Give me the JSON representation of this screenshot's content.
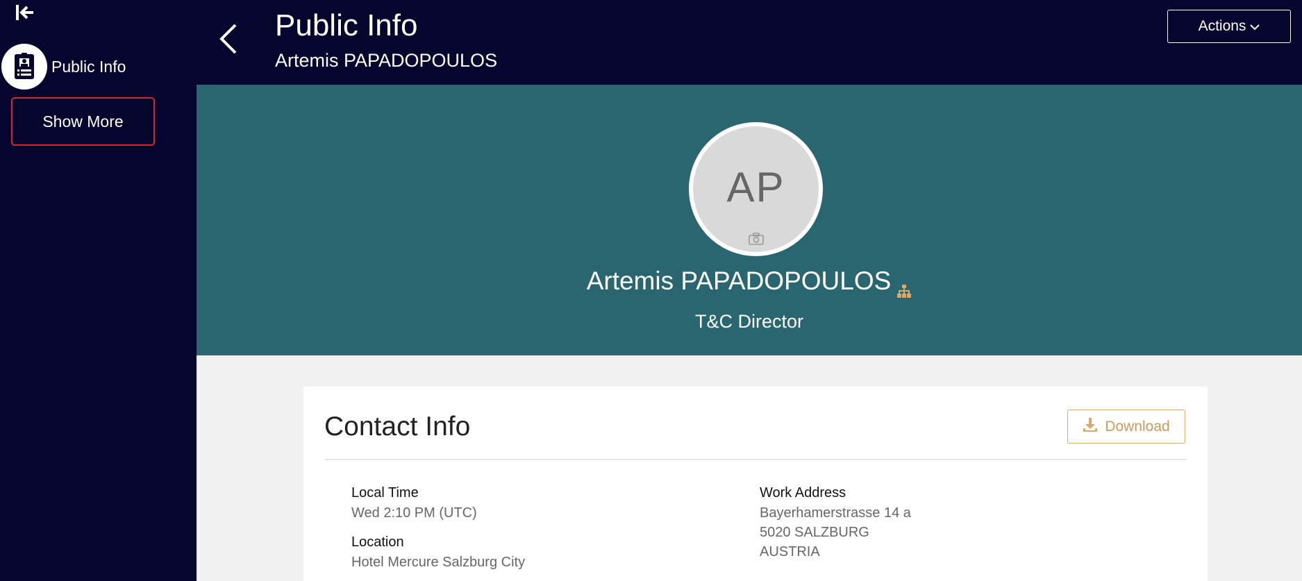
{
  "sidebar": {
    "items": [
      {
        "label": "Public Info",
        "icon": "id-badge-icon"
      }
    ],
    "show_more_label": "Show More"
  },
  "header": {
    "title": "Public Info",
    "subtitle": "Artemis PAPADOPOULOS",
    "actions_label": "Actions"
  },
  "profile": {
    "initials": "AP",
    "name": "Artemis PAPADOPOULOS",
    "job_title": "T&C Director"
  },
  "contact": {
    "title": "Contact Info",
    "download_label": "Download",
    "local_time_label": "Local Time",
    "local_time_value": "Wed 2:10 PM (UTC)",
    "location_label": "Location",
    "location_value": "Hotel Mercure Salzburg City",
    "work_address_label": "Work Address",
    "work_address_lines": [
      "Bayerhamerstrasse 14 a",
      "5020 SALZBURG",
      "AUSTRIA"
    ]
  },
  "colors": {
    "nav_bg": "#05052e",
    "banner_bg": "#2a6670",
    "accent_gold": "#c99a5c",
    "focus_red": "#d9262c"
  }
}
